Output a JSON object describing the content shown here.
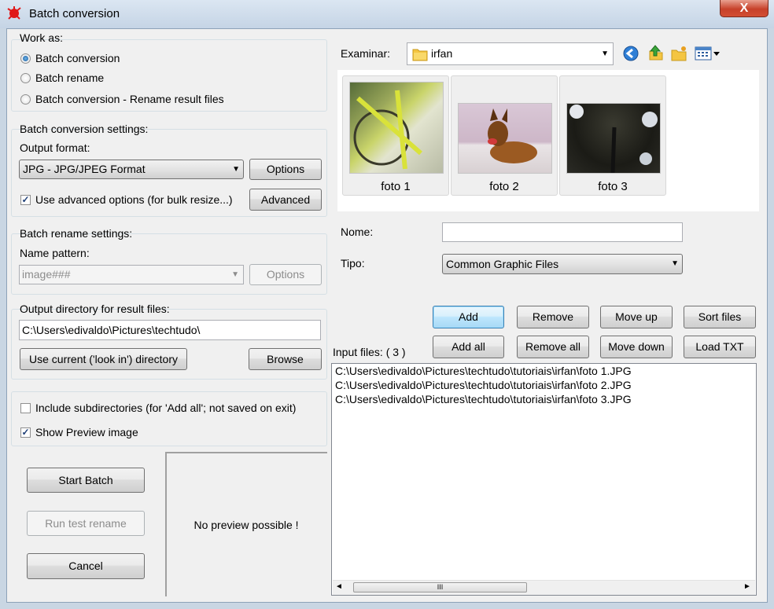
{
  "window": {
    "title": "Batch conversion",
    "close_glyph": "X"
  },
  "work_as": {
    "title": "Work as:",
    "options": [
      "Batch conversion",
      "Batch rename",
      "Batch conversion - Rename result files"
    ],
    "selected": 0
  },
  "conversion": {
    "title": "Batch conversion settings:",
    "output_format_label": "Output format:",
    "format_value": "JPG - JPG/JPEG Format",
    "options_button": "Options",
    "advanced_check_label": "Use advanced options (for bulk resize...)",
    "advanced_checked": true,
    "advanced_button": "Advanced"
  },
  "rename": {
    "title": "Batch rename settings:",
    "pattern_label": "Name pattern:",
    "pattern_value": "image###",
    "options_button": "Options"
  },
  "output_dir": {
    "title": "Output directory for result files:",
    "value": "C:\\Users\\edivaldo\\Pictures\\techtudo\\",
    "use_current_button": "Use current ('look in') directory",
    "browse_button": "Browse"
  },
  "checks": {
    "subdirs_label": "Include subdirectories (for 'Add all'; not saved on exit)",
    "subdirs_checked": false,
    "preview_label": "Show Preview image",
    "preview_checked": true
  },
  "actions": {
    "start": "Start Batch",
    "test_rename": "Run test rename",
    "cancel": "Cancel"
  },
  "preview": {
    "text": "No preview possible !"
  },
  "browser": {
    "look_in_label": "Examinar:",
    "folder": "irfan",
    "thumbnails": [
      "foto 1",
      "foto 2",
      "foto 3"
    ],
    "name_label": "Nome:",
    "name_value": "",
    "type_label": "Tipo:",
    "type_value": "Common Graphic Files"
  },
  "file_buttons": {
    "add": "Add",
    "remove": "Remove",
    "move_up": "Move up",
    "sort": "Sort files",
    "add_all": "Add all",
    "remove_all": "Remove all",
    "move_down": "Move down",
    "load_txt": "Load TXT"
  },
  "input_files": {
    "label": "Input files: ( 3 )",
    "files": [
      "C:\\Users\\edivaldo\\Pictures\\techtudo\\tutoriais\\irfan\\foto 1.JPG",
      "C:\\Users\\edivaldo\\Pictures\\techtudo\\tutoriais\\irfan\\foto 2.JPG",
      "C:\\Users\\edivaldo\\Pictures\\techtudo\\tutoriais\\irfan\\foto 3.JPG"
    ],
    "scroll_left": "◄",
    "scroll_right": "►",
    "scroll_grip": "III"
  },
  "colors": {
    "accent": "#3c7fb1",
    "close": "#c7412a"
  }
}
